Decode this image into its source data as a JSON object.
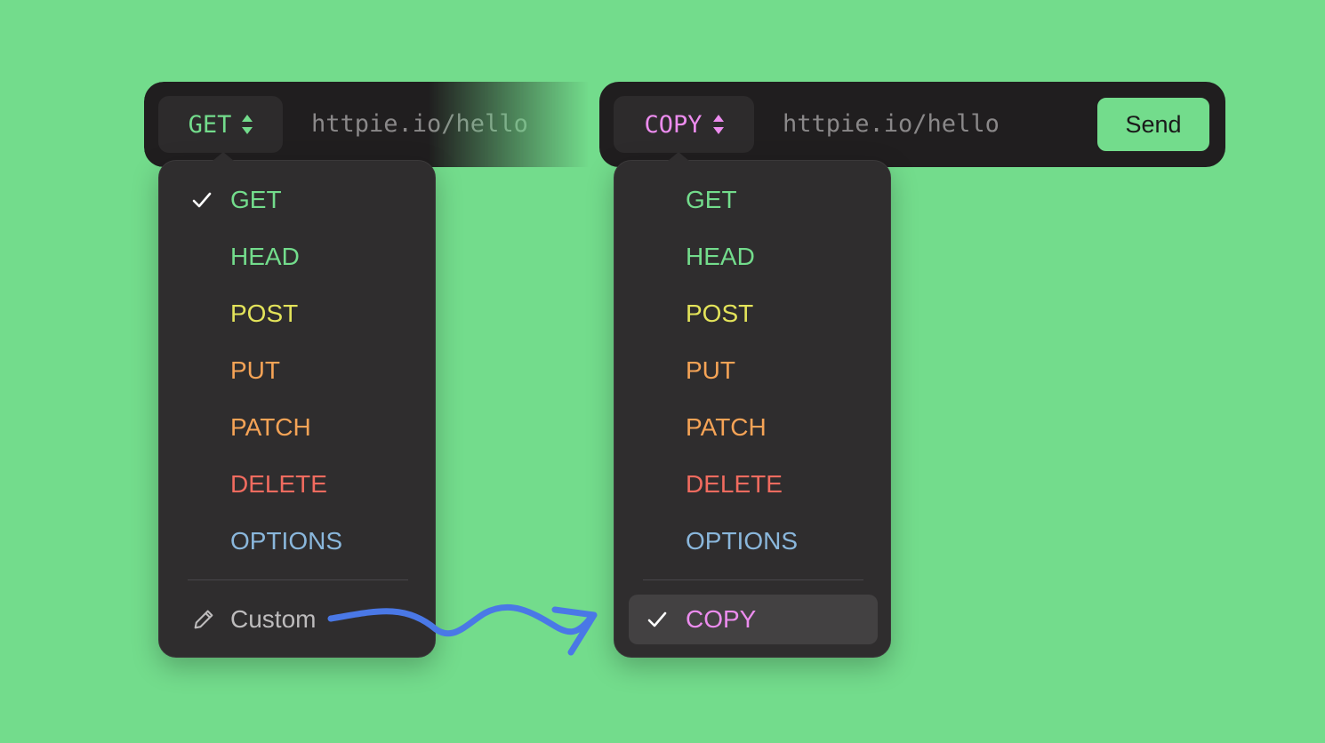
{
  "left_panel": {
    "method": "GET",
    "url": "httpie.io/hello",
    "menu": {
      "items": [
        {
          "label": "GET",
          "color": "#73dc8c",
          "selected": true
        },
        {
          "label": "HEAD",
          "color": "#73dc8c",
          "selected": false
        },
        {
          "label": "POST",
          "color": "#e3e35a",
          "selected": false
        },
        {
          "label": "PUT",
          "color": "#f5a356",
          "selected": false
        },
        {
          "label": "PATCH",
          "color": "#f5a356",
          "selected": false
        },
        {
          "label": "DELETE",
          "color": "#f16b5f",
          "selected": false
        },
        {
          "label": "OPTIONS",
          "color": "#8ab7dc",
          "selected": false
        }
      ],
      "custom": {
        "label": "Custom",
        "icon": "pencil-icon",
        "color": "#bdbbbc"
      }
    }
  },
  "right_panel": {
    "method": "COPY",
    "url": "httpie.io/hello",
    "send_label": "Send",
    "menu": {
      "items": [
        {
          "label": "GET",
          "color": "#73dc8c",
          "selected": false
        },
        {
          "label": "HEAD",
          "color": "#73dc8c",
          "selected": false
        },
        {
          "label": "POST",
          "color": "#e3e35a",
          "selected": false
        },
        {
          "label": "PUT",
          "color": "#f5a356",
          "selected": false
        },
        {
          "label": "PATCH",
          "color": "#f5a356",
          "selected": false
        },
        {
          "label": "DELETE",
          "color": "#f16b5f",
          "selected": false
        },
        {
          "label": "OPTIONS",
          "color": "#8ab7dc",
          "selected": false
        }
      ],
      "custom": {
        "label": "COPY",
        "color": "#ec8cee",
        "selected": true
      }
    }
  },
  "colors": {
    "background": "#73dc8c",
    "bar": "#201e1f",
    "menu": "#2f2d2e",
    "arrow": "#4a78e6"
  }
}
